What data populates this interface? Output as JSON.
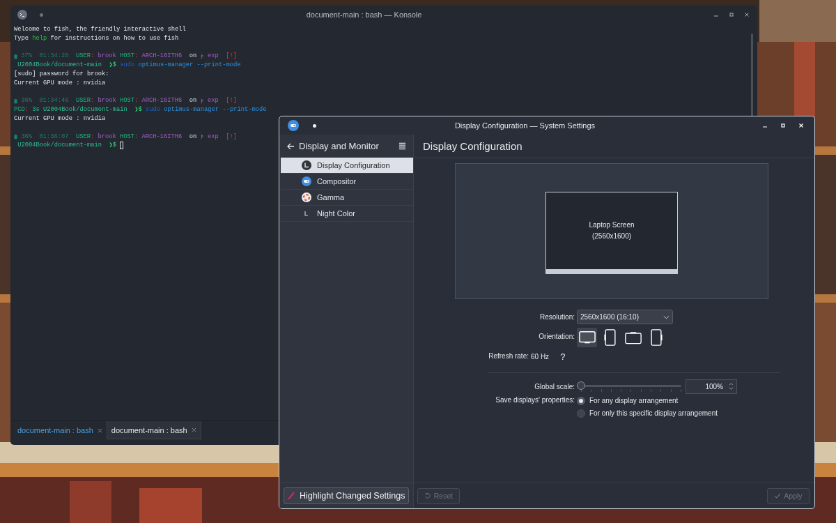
{
  "terminal": {
    "title": "document-main : bash — Konsole",
    "lines": [
      {
        "segments": [
          {
            "kind": "plain",
            "text": "Welcome to fish, the friendly interactive shell"
          }
        ]
      },
      {
        "segments": [
          {
            "kind": "plain",
            "text": "Type "
          },
          {
            "kind": "green",
            "text": "help"
          },
          {
            "kind": "plain",
            "text": " for instructions on how to use fish"
          }
        ]
      },
      {
        "kind": "blank"
      },
      {
        "segments": [
          {
            "kind": "battery"
          },
          {
            "kind": "dim",
            "text": " 37%  01:34:28  "
          },
          {
            "kind": "label",
            "text": "USER"
          },
          {
            "kind": "sep",
            "text": ":"
          },
          {
            "kind": "purple",
            "text": " brook "
          },
          {
            "kind": "label",
            "text": "HOST"
          },
          {
            "kind": "sep",
            "text": ":"
          },
          {
            "kind": "purple",
            "text": " ARCH-16ITH6"
          },
          {
            "kind": "plain",
            "text": "  on "
          },
          {
            "kind": "branch"
          },
          {
            "kind": "purple",
            "text": " exp"
          },
          {
            "kind": "red",
            "text": "  [!]"
          }
        ]
      },
      {
        "segments": [
          {
            "kind": "path",
            "text": " U2004Book/document-main  "
          },
          {
            "kind": "prompt",
            "text": "❯$ "
          },
          {
            "kind": "cmddim",
            "text": "sudo"
          },
          {
            "kind": "cmd",
            "text": " optimus-manager --print-mode"
          }
        ]
      },
      {
        "segments": [
          {
            "kind": "plain",
            "text": "[sudo] password for brook:"
          }
        ]
      },
      {
        "segments": [
          {
            "kind": "plain",
            "text": "Current GPU mode : nvidia"
          }
        ]
      },
      {
        "kind": "blank"
      },
      {
        "segments": [
          {
            "kind": "battery"
          },
          {
            "kind": "dim",
            "text": " 36%  01:34:46  "
          },
          {
            "kind": "label",
            "text": "USER"
          },
          {
            "kind": "sep",
            "text": ":"
          },
          {
            "kind": "purple",
            "text": " brook "
          },
          {
            "kind": "label",
            "text": "HOST"
          },
          {
            "kind": "sep",
            "text": ":"
          },
          {
            "kind": "purple",
            "text": " ARCH-16ITH6"
          },
          {
            "kind": "plain",
            "text": "  on "
          },
          {
            "kind": "branch"
          },
          {
            "kind": "purple",
            "text": " exp"
          },
          {
            "kind": "red",
            "text": "  [!]"
          }
        ]
      },
      {
        "segments": [
          {
            "kind": "label",
            "text": "PCD"
          },
          {
            "kind": "sep",
            "text": ":"
          },
          {
            "kind": "path",
            "text": " 3s U2004Book/document-main  "
          },
          {
            "kind": "prompt",
            "text": "❯$ "
          },
          {
            "kind": "cmddim",
            "text": "sudo"
          },
          {
            "kind": "cmd",
            "text": " optimus-manager --print-mode"
          }
        ]
      },
      {
        "segments": [
          {
            "kind": "plain",
            "text": "Current GPU mode : nvidia"
          }
        ]
      },
      {
        "kind": "blank"
      },
      {
        "segments": [
          {
            "kind": "battery"
          },
          {
            "kind": "dim",
            "text": " 36%  01:36:07  "
          },
          {
            "kind": "label",
            "text": "USER"
          },
          {
            "kind": "sep",
            "text": ":"
          },
          {
            "kind": "purple",
            "text": " brook "
          },
          {
            "kind": "label",
            "text": "HOST"
          },
          {
            "kind": "sep",
            "text": ":"
          },
          {
            "kind": "purple",
            "text": " ARCH-16ITH6"
          },
          {
            "kind": "plain",
            "text": "  on "
          },
          {
            "kind": "branch"
          },
          {
            "kind": "purple",
            "text": " exp"
          },
          {
            "kind": "red",
            "text": "  [!]"
          }
        ]
      },
      {
        "segments": [
          {
            "kind": "path",
            "text": " U2004Book/document-main  "
          },
          {
            "kind": "prompt",
            "text": "❯$ "
          },
          {
            "kind": "cursor"
          }
        ]
      }
    ],
    "tabs": [
      {
        "label": "document-main : bash",
        "selected": true
      },
      {
        "label": "document-main : bash",
        "selected": false
      }
    ]
  },
  "settings": {
    "title": "Display Configuration — System Settings",
    "sidebar": {
      "back_label": "Display and Monitor",
      "items": [
        {
          "label": "Display Configuration",
          "kind": "display",
          "selected": true
        },
        {
          "label": "Compositor",
          "kind": "compositor",
          "selected": false
        },
        {
          "label": "Gamma",
          "kind": "gamma",
          "selected": false
        },
        {
          "label": "Night Color",
          "kind": "night",
          "selected": false
        }
      ]
    },
    "page_title": "Display Configuration",
    "preview": {
      "name": "Laptop Screen",
      "resolution": "(2560x1600)"
    },
    "resolution": {
      "label": "Resolution:",
      "value": "2560x1600 (16:10)"
    },
    "orientation": {
      "label": "Orientation:",
      "options": [
        {
          "kind": "landscape",
          "selected": true
        },
        {
          "kind": "portrait-left",
          "selected": false
        },
        {
          "kind": "landscape-flipped",
          "selected": false
        },
        {
          "kind": "portrait-right",
          "selected": false
        }
      ]
    },
    "refresh": {
      "label": "Refresh rate:",
      "value": "60 Hz",
      "help": "?"
    },
    "global_scale": {
      "label": "Global scale:",
      "level": 0,
      "value": "100%"
    },
    "save_properties": {
      "label": "Save displays' properties:",
      "options": [
        {
          "label": "For any display arrangement",
          "selected": true
        },
        {
          "label": "For only this specific display arrangement",
          "selected": false
        }
      ]
    },
    "highlight_button": {
      "label": "Highlight Changed Settings"
    },
    "reset_button": {
      "label": "Reset",
      "disabled": true
    },
    "apply_button": {
      "label": "Apply",
      "disabled": true
    }
  }
}
